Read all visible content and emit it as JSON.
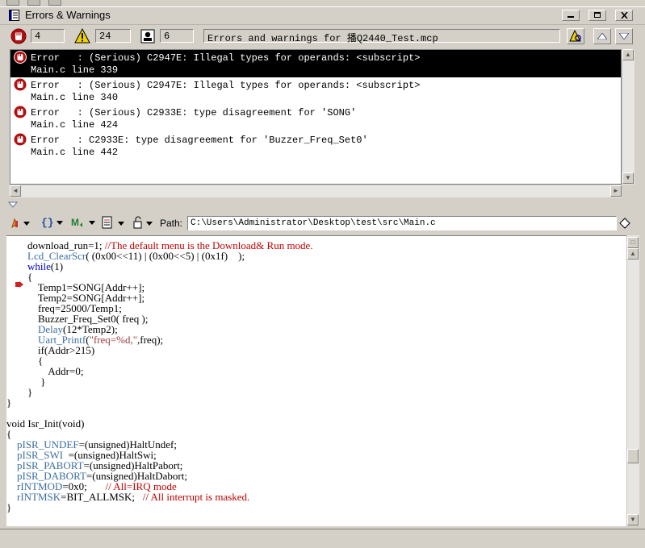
{
  "window": {
    "title": "Errors & Warnings",
    "buttons": {
      "minimize": "minimize",
      "restore": "restore",
      "close": "close"
    }
  },
  "counts": {
    "errors": "4",
    "warnings": "24",
    "messages": "6",
    "summary": "Errors and warnings for 播Q2440_Test.mcp"
  },
  "errors": [
    {
      "line1": "Error   : (Serious) C2947E: Illegal types for operands: <subscript>",
      "line2": "Main.c line 339",
      "selected": true
    },
    {
      "line1": "Error   : (Serious) C2947E: Illegal types for operands: <subscript>",
      "line2": "Main.c line 340",
      "selected": false
    },
    {
      "line1": "Error   : (Serious) C2933E: type disagreement for 'SONG'",
      "line2": "Main.c line 424",
      "selected": false
    },
    {
      "line1": "Error   : C2933E: type disagreement for 'Buzzer_Freq_Set0'",
      "line2": "Main.c line 442",
      "selected": false
    }
  ],
  "editor_toolbar": {
    "path_label": "Path:",
    "path_value": "C:\\Users\\Administrator\\Desktop\\test\\src\\Main.c",
    "icons": [
      "function-icon",
      "braces-icon",
      "markers-icon",
      "document-icon",
      "lock-icon"
    ]
  },
  "code_lines": [
    [
      {
        "t": "        download_run=1; "
      },
      {
        "t": "//The default menu is the Download& Run mode.",
        "c": "cm"
      }
    ],
    [
      {
        "t": "        "
      },
      {
        "t": "Lcd_ClearScr",
        "c": "fn"
      },
      {
        "t": "( (0x00<<11) | (0x00<<5) | (0x1f)    );"
      }
    ],
    [
      {
        "t": "        "
      },
      {
        "t": "while",
        "c": "kw"
      },
      {
        "t": "(1)"
      }
    ],
    [
      {
        "t": "        {"
      }
    ],
    [
      {
        "t": "            Temp1=SONG[Addr++];"
      }
    ],
    [
      {
        "t": "            Temp2=SONG[Addr++];"
      }
    ],
    [
      {
        "t": "            freq=25000/Temp1;"
      }
    ],
    [
      {
        "t": "            Buzzer_Freq_Set0( freq );"
      }
    ],
    [
      {
        "t": "            "
      },
      {
        "t": "Delay",
        "c": "fn"
      },
      {
        "t": "(12*Temp2);"
      }
    ],
    [
      {
        "t": "            "
      },
      {
        "t": "Uart_Printf",
        "c": "fn"
      },
      {
        "t": "("
      },
      {
        "t": "\"freq=%d,\"",
        "c": "str"
      },
      {
        "t": ",freq);"
      }
    ],
    [
      {
        "t": "            if(Addr>215)"
      }
    ],
    [
      {
        "t": "            {"
      }
    ],
    [
      {
        "t": "                Addr=0;"
      }
    ],
    [
      {
        "t": "             }"
      }
    ],
    [
      {
        "t": "        }"
      }
    ],
    [
      {
        "t": "}"
      }
    ],
    [
      {
        "t": ""
      }
    ],
    [
      {
        "t": "void Isr_Init(void)"
      }
    ],
    [
      {
        "t": "{"
      }
    ],
    [
      {
        "t": "    "
      },
      {
        "t": "pISR_UNDEF",
        "c": "fn"
      },
      {
        "t": "=(unsigned)HaltUndef;"
      }
    ],
    [
      {
        "t": "    "
      },
      {
        "t": "pISR_SWI",
        "c": "fn"
      },
      {
        "t": "  =(unsigned)HaltSwi;"
      }
    ],
    [
      {
        "t": "    "
      },
      {
        "t": "pISR_PABORT",
        "c": "fn"
      },
      {
        "t": "=(unsigned)HaltPabort;"
      }
    ],
    [
      {
        "t": "    "
      },
      {
        "t": "pISR_DABORT",
        "c": "fn"
      },
      {
        "t": "=(unsigned)HaltDabort;"
      }
    ],
    [
      {
        "t": "    "
      },
      {
        "t": "rINTMOD",
        "c": "fn"
      },
      {
        "t": "=0x0;       "
      },
      {
        "t": "// All=IRQ mode",
        "c": "cm"
      }
    ],
    [
      {
        "t": "    "
      },
      {
        "t": "rINTMSK",
        "c": "fn"
      },
      {
        "t": "=BIT_ALLMSK;   "
      },
      {
        "t": "// All interrupt is masked.",
        "c": "cm"
      }
    ],
    [
      {
        "t": "}"
      }
    ]
  ],
  "colors": {
    "selection_bg": "#000000",
    "keyword": "#0000cc",
    "function": "#3c6ea0",
    "comment": "#c00000",
    "string": "#9a3b3b"
  }
}
